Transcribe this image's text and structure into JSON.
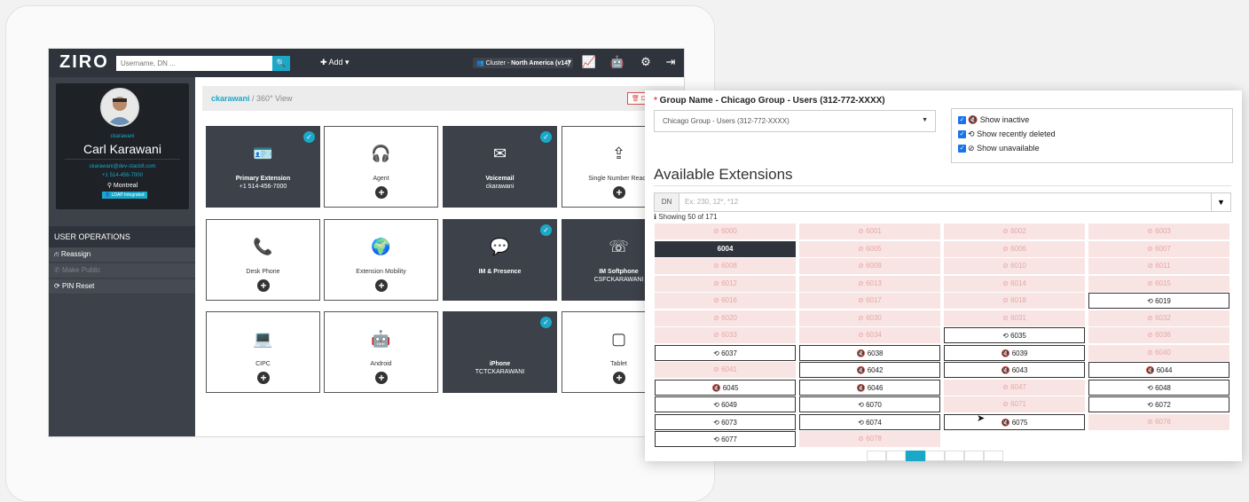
{
  "app": {
    "logo": "ZIRO",
    "search_placeholder": "Username, DN ...",
    "search_button": "🔍",
    "add_menu": "✚ Add ▾",
    "cluster_prefix": "Cluster - ",
    "cluster_name": "North America (v14)"
  },
  "profile": {
    "username": "ckarawani",
    "full_name": "Carl Karawani",
    "email": "ckarawani@dev-stack8.com",
    "phone": "+1 514-456-7000",
    "location": "Montreal",
    "ldap_badge": "LDAP Integrated"
  },
  "user_operations": {
    "title": "USER OPERATIONS",
    "items": [
      {
        "label": "Reassign",
        "icon": "⛙",
        "enabled": true
      },
      {
        "label": "Make Public",
        "icon": "✆",
        "enabled": false
      },
      {
        "label": "PIN Reset",
        "icon": "⟳",
        "enabled": true
      }
    ]
  },
  "breadcrumb": {
    "user": "ckarawani",
    "sep": " / ",
    "view": "360° View"
  },
  "delete_button": "🗑 Delete All",
  "tiles": [
    {
      "label": "Primary Extension",
      "sub": "+1 514-456-7000",
      "icon": "🪪",
      "dark": true,
      "check": true,
      "plus": false
    },
    {
      "label": "Agent",
      "sub": "",
      "icon": "🎧",
      "dark": false,
      "check": false,
      "plus": true
    },
    {
      "label": "Voicemail",
      "sub": "ckarawani",
      "icon": "✉",
      "dark": true,
      "check": true,
      "plus": false
    },
    {
      "label": "Single Number Reach",
      "sub": "",
      "icon": "⇪",
      "dark": false,
      "check": false,
      "plus": true
    },
    {
      "label": "Desk Phone",
      "sub": "",
      "icon": "📞",
      "dark": false,
      "check": false,
      "plus": true
    },
    {
      "label": "Extension Mobility",
      "sub": "",
      "icon": "🌍",
      "dark": false,
      "check": false,
      "plus": true
    },
    {
      "label": "IM & Presence",
      "sub": "",
      "icon": "💬",
      "dark": true,
      "check": true,
      "plus": false
    },
    {
      "label": "IM Softphone",
      "sub": "CSFCKARAWANI",
      "icon": "☏",
      "dark": true,
      "check": false,
      "plus": false
    },
    {
      "label": "CIPC",
      "sub": "",
      "icon": "💻",
      "dark": false,
      "check": false,
      "plus": true
    },
    {
      "label": "Android",
      "sub": "",
      "icon": "🤖",
      "dark": false,
      "check": false,
      "plus": true
    },
    {
      "label": "iPhone",
      "sub": "TCTCKARAWANI",
      "icon": "",
      "dark": true,
      "check": true,
      "plus": false
    },
    {
      "label": "Tablet",
      "sub": "",
      "icon": "▢",
      "dark": false,
      "check": false,
      "plus": true
    }
  ],
  "panel": {
    "group_label_req": "* ",
    "group_label": "Group Name - Chicago Group - Users (312-772-XXXX)",
    "group_value": "Chicago Group - Users (312-772-XXXX)",
    "options": [
      {
        "label": "Show inactive",
        "icon": "🔇"
      },
      {
        "label": "Show recently deleted",
        "icon": "⟲"
      },
      {
        "label": "Show unavailable",
        "icon": "⊘"
      }
    ],
    "title": "Available Extensions",
    "dn_label": "DN",
    "dn_placeholder": "Ex: 230, 12*, *12",
    "filter_icon": "▼",
    "showing": "Showing 50 of 171",
    "extensions": [
      {
        "n": "6000",
        "s": "u"
      },
      {
        "n": "6001",
        "s": "u"
      },
      {
        "n": "6002",
        "s": "u"
      },
      {
        "n": "6003",
        "s": "u"
      },
      {
        "n": "6004",
        "s": "sel"
      },
      {
        "n": "6005",
        "s": "u"
      },
      {
        "n": "6006",
        "s": "u"
      },
      {
        "n": "6007",
        "s": "u"
      },
      {
        "n": "6008",
        "s": "u"
      },
      {
        "n": "6009",
        "s": "u"
      },
      {
        "n": "6010",
        "s": "u"
      },
      {
        "n": "6011",
        "s": "u"
      },
      {
        "n": "6012",
        "s": "u"
      },
      {
        "n": "6013",
        "s": "u"
      },
      {
        "n": "6014",
        "s": "u"
      },
      {
        "n": "6015",
        "s": "u"
      },
      {
        "n": "6016",
        "s": "u"
      },
      {
        "n": "6017",
        "s": "u"
      },
      {
        "n": "6018",
        "s": "u"
      },
      {
        "n": "6019",
        "s": "d"
      },
      {
        "n": "6020",
        "s": "u"
      },
      {
        "n": "6030",
        "s": "u"
      },
      {
        "n": "6031",
        "s": "u"
      },
      {
        "n": "6032",
        "s": "u"
      },
      {
        "n": "6033",
        "s": "u"
      },
      {
        "n": "6034",
        "s": "u"
      },
      {
        "n": "6035",
        "s": "d"
      },
      {
        "n": "6036",
        "s": "u"
      },
      {
        "n": "6037",
        "s": "d"
      },
      {
        "n": "6038",
        "s": "i"
      },
      {
        "n": "6039",
        "s": "i"
      },
      {
        "n": "6040",
        "s": "u"
      },
      {
        "n": "6041",
        "s": "u"
      },
      {
        "n": "6042",
        "s": "i"
      },
      {
        "n": "6043",
        "s": "i"
      },
      {
        "n": "6044",
        "s": "i"
      },
      {
        "n": "6045",
        "s": "i"
      },
      {
        "n": "6046",
        "s": "i"
      },
      {
        "n": "6047",
        "s": "u"
      },
      {
        "n": "6048",
        "s": "d"
      },
      {
        "n": "6049",
        "s": "d"
      },
      {
        "n": "6070",
        "s": "d"
      },
      {
        "n": "6071",
        "s": "u"
      },
      {
        "n": "6072",
        "s": "d"
      },
      {
        "n": "6073",
        "s": "d"
      },
      {
        "n": "6074",
        "s": "d"
      },
      {
        "n": "6075",
        "s": "i"
      },
      {
        "n": "6076",
        "s": "u"
      },
      {
        "n": "6077",
        "s": "d"
      },
      {
        "n": "6078",
        "s": "u"
      }
    ]
  }
}
